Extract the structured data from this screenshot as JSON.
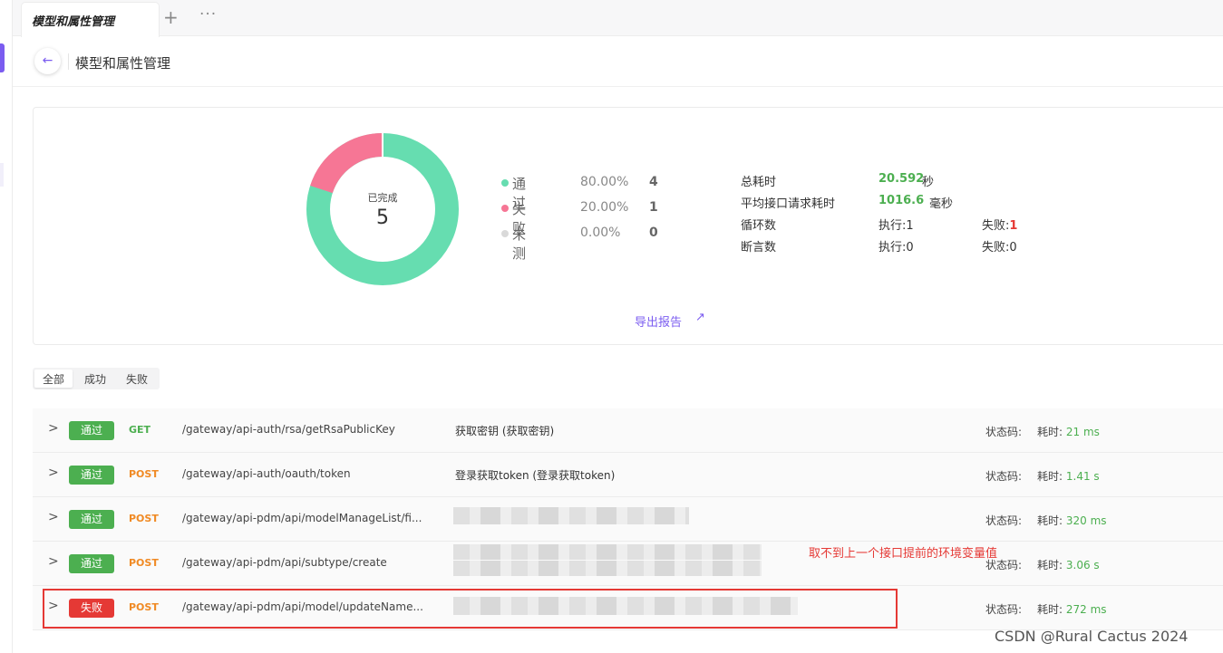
{
  "tabs": [
    {
      "label": "模型和属性管理",
      "active": true
    }
  ],
  "tab_actions": {
    "add_icon": "plus-icon",
    "more_icon": "more-icon"
  },
  "header": {
    "title": "模型和属性管理",
    "back_icon": "arrow-left-icon"
  },
  "summary": {
    "donut": {
      "label": "已完成",
      "value": "5"
    },
    "legend": [
      {
        "name": "通过",
        "pct": "80.00%",
        "count": "4",
        "color": "#66ddb0"
      },
      {
        "name": "失败",
        "pct": "20.00%",
        "count": "1",
        "color": "#f67695"
      },
      {
        "name": "未测",
        "pct": "0.00%",
        "count": "0",
        "color": "#d9d9d9"
      }
    ],
    "stats": {
      "total_time_label": "总耗时",
      "total_time_value": "20.592",
      "total_time_unit": "秒",
      "avg_time_label": "平均接口请求耗时",
      "avg_time_value": "1016.6",
      "avg_time_unit": "毫秒",
      "loop_label": "循环数",
      "loop_exec": "执行:1",
      "loop_fail_label": "失败:",
      "loop_fail_value": "1",
      "assert_label": "断言数",
      "assert_exec": "执行:0",
      "assert_fail": "失败:0"
    },
    "export_label": "导出报告",
    "export_icon": "external-link-icon"
  },
  "filters": [
    {
      "label": "全部",
      "active": true
    },
    {
      "label": "成功",
      "active": false
    },
    {
      "label": "失败",
      "active": false
    }
  ],
  "requests": [
    {
      "status": "通过",
      "status_color": "#4caf50",
      "method": "GET",
      "method_color": "#4caf50",
      "path": "/gateway/api-auth/rsa/getRsaPublicKey",
      "desc": "获取密钥 (获取密钥)",
      "status_code_label": "状态码:",
      "time_label": "耗时:",
      "time": "21 ms"
    },
    {
      "status": "通过",
      "status_color": "#4caf50",
      "method": "POST",
      "method_color": "#f08a24",
      "path": "/gateway/api-auth/oauth/token",
      "desc": "登录获取token (登录获取token)",
      "status_code_label": "状态码:",
      "time_label": "耗时:",
      "time": "1.41 s"
    },
    {
      "status": "通过",
      "status_color": "#4caf50",
      "method": "POST",
      "method_color": "#f08a24",
      "path": "/gateway/api-pdm/api/modelManageList/fi...",
      "desc": "",
      "status_code_label": "状态码:",
      "time_label": "耗时:",
      "time": "320 ms"
    },
    {
      "status": "通过",
      "status_color": "#4caf50",
      "method": "POST",
      "method_color": "#f08a24",
      "path": "/gateway/api-pdm/api/subtype/create",
      "desc": "",
      "status_code_label": "状态码:",
      "time_label": "耗时:",
      "time": "3.06 s"
    },
    {
      "status": "失败",
      "status_color": "#e53935",
      "method": "POST",
      "method_color": "#f08a24",
      "path": "/gateway/api-pdm/api/model/updateName...",
      "desc": "",
      "status_code_label": "状态码:",
      "time_label": "耗时:",
      "time": "272 ms"
    }
  ],
  "annotation": "取不到上一个接口提前的环境变量值",
  "watermark": "CSDN @Rural Cactus 2024"
}
